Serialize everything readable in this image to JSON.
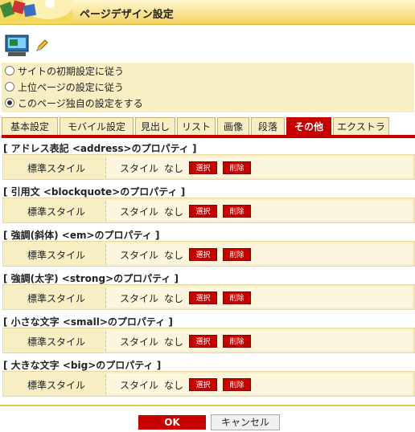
{
  "header": {
    "title": "ページデザイン設定"
  },
  "radios": [
    {
      "label": "サイトの初期設定に従う",
      "checked": false
    },
    {
      "label": "上位ページの設定に従う",
      "checked": false
    },
    {
      "label": "このページ独自の設定をする",
      "checked": true
    }
  ],
  "tabs": [
    {
      "label": "基本設定",
      "active": false
    },
    {
      "label": "モバイル設定",
      "active": false
    },
    {
      "label": "見出し",
      "active": false
    },
    {
      "label": "リスト",
      "active": false
    },
    {
      "label": "画像",
      "active": false
    },
    {
      "label": "段落",
      "active": false
    },
    {
      "label": "その他",
      "active": true
    },
    {
      "label": "エクストラ",
      "active": false
    }
  ],
  "sections": [
    {
      "title": "[ アドレス表記 <address>のプロパティ ]",
      "prop": "標準スタイル",
      "style": "スタイル",
      "value": "なし",
      "select": "選択",
      "delete": "削除"
    },
    {
      "title": "[ 引用文 <blockquote>のプロパティ ]",
      "prop": "標準スタイル",
      "style": "スタイル",
      "value": "なし",
      "select": "選択",
      "delete": "削除"
    },
    {
      "title": "[ 強調(斜体) <em>のプロパティ ]",
      "prop": "標準スタイル",
      "style": "スタイル",
      "value": "なし",
      "select": "選択",
      "delete": "削除"
    },
    {
      "title": "[ 強調(太字) <strong>のプロパティ ]",
      "prop": "標準スタイル",
      "style": "スタイル",
      "value": "なし",
      "select": "選択",
      "delete": "削除"
    },
    {
      "title": "[ 小さな文字 <small>のプロパティ ]",
      "prop": "標準スタイル",
      "style": "スタイル",
      "value": "なし",
      "select": "選択",
      "delete": "削除"
    },
    {
      "title": "[ 大きな文字 <big>のプロパティ ]",
      "prop": "標準スタイル",
      "style": "スタイル",
      "value": "なし",
      "select": "選択",
      "delete": "削除"
    }
  ],
  "footer": {
    "ok": "OK",
    "cancel": "キャンセル"
  },
  "colors": {
    "accent": "#c70000",
    "panel": "#f7efc3",
    "header": "#f3d35e"
  }
}
